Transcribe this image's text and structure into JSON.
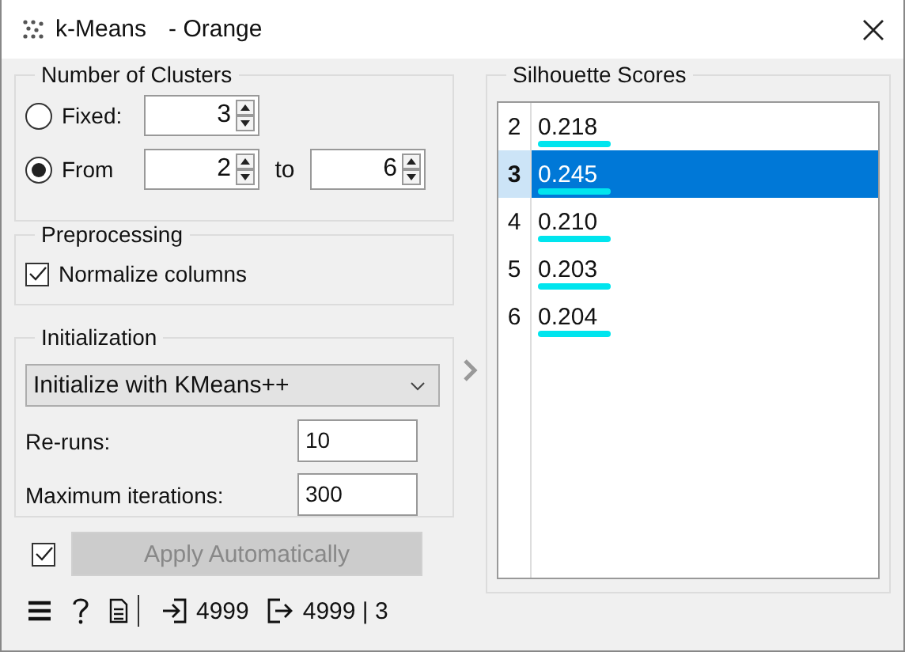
{
  "window": {
    "title": "k-Means",
    "subtitle": "- Orange"
  },
  "clusters": {
    "title": "Number of Clusters",
    "options": [
      {
        "label": "Fixed:",
        "selected": false,
        "kind": "single",
        "value": "3"
      },
      {
        "label": "From",
        "selected": true,
        "kind": "range",
        "value": "2",
        "separator": "to",
        "value_to": "6"
      }
    ]
  },
  "preprocessing": {
    "title": "Preprocessing",
    "checkbox": {
      "label": "Normalize columns",
      "checked": true
    }
  },
  "initialization": {
    "title": "Initialization",
    "method": "Initialize with KMeans++",
    "fields": [
      {
        "label": "Re-runs:",
        "value": "10"
      },
      {
        "label": "Maximum iterations:",
        "value": "300"
      }
    ]
  },
  "apply": {
    "checked": true,
    "label": "Apply Automatically",
    "disabled": true
  },
  "status_bar": {
    "input_count": "4999",
    "output_count": "4999 | 3"
  },
  "scores": {
    "title": "Silhouette Scores",
    "rows": [
      {
        "k": "2",
        "score": "0.218",
        "selected": false,
        "highlighted": true
      },
      {
        "k": "3",
        "score": "0.245",
        "selected": true,
        "highlighted": true
      },
      {
        "k": "4",
        "score": "0.210",
        "selected": false,
        "highlighted": true
      },
      {
        "k": "5",
        "score": "0.203",
        "selected": false,
        "highlighted": true
      },
      {
        "k": "6",
        "score": "0.204",
        "selected": false,
        "highlighted": true
      }
    ]
  }
}
